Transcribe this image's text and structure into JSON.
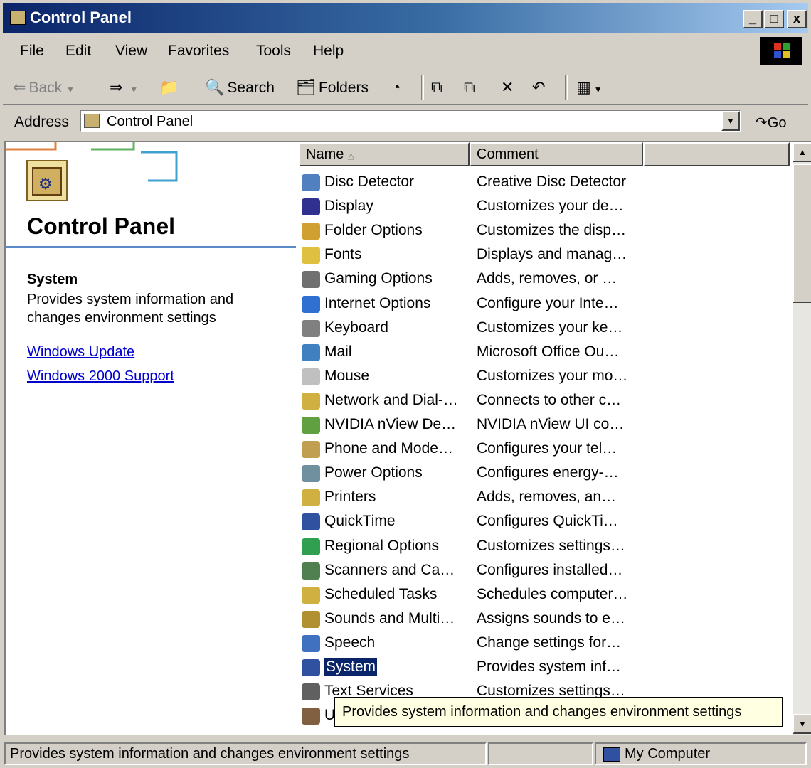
{
  "window": {
    "title": "Control Panel",
    "minimize": "_",
    "maximize": "□",
    "close": "x"
  },
  "menu": [
    "File",
    "Edit",
    "View",
    "Favorites",
    "Tools",
    "Help"
  ],
  "toolbar": {
    "back": "Back",
    "search": "Search",
    "folders": "Folders"
  },
  "address": {
    "label": "Address",
    "value": "Control Panel",
    "go": "Go"
  },
  "left_pane": {
    "title": "Control Panel",
    "selected_name": "System",
    "selected_desc": "Provides system information and changes environment settings",
    "links": [
      "Windows Update",
      "Windows 2000 Support"
    ]
  },
  "columns": [
    "Name",
    "Comment"
  ],
  "items": [
    {
      "name": "Disc Detector",
      "comment": "Creative Disc Detector",
      "color": "#5080c0"
    },
    {
      "name": "Display",
      "comment": "Customizes your de…",
      "color": "#303090"
    },
    {
      "name": "Folder Options",
      "comment": "Customizes the disp…",
      "color": "#d0a030"
    },
    {
      "name": "Fonts",
      "comment": "Displays and manag…",
      "color": "#e0c040"
    },
    {
      "name": "Gaming Options",
      "comment": "Adds, removes, or …",
      "color": "#707070"
    },
    {
      "name": "Internet Options",
      "comment": "Configure your Inte…",
      "color": "#3070d0"
    },
    {
      "name": "Keyboard",
      "comment": "Customizes your ke…",
      "color": "#808080"
    },
    {
      "name": "Mail",
      "comment": "Microsoft Office Ou…",
      "color": "#4080c0"
    },
    {
      "name": "Mouse",
      "comment": "Customizes your mo…",
      "color": "#c0c0c0"
    },
    {
      "name": "Network and Dial-…",
      "comment": "Connects to other c…",
      "color": "#d0b040"
    },
    {
      "name": "NVIDIA nView De…",
      "comment": "NVIDIA nView UI co…",
      "color": "#60a040"
    },
    {
      "name": "Phone and Mode…",
      "comment": "Configures your tel…",
      "color": "#c0a050"
    },
    {
      "name": "Power Options",
      "comment": "Configures energy-…",
      "color": "#7090a0"
    },
    {
      "name": "Printers",
      "comment": "Adds, removes, an…",
      "color": "#d0b040"
    },
    {
      "name": "QuickTime",
      "comment": "Configures QuickTi…",
      "color": "#3050a0"
    },
    {
      "name": "Regional Options",
      "comment": "Customizes settings…",
      "color": "#30a050"
    },
    {
      "name": "Scanners and Ca…",
      "comment": "Configures installed…",
      "color": "#508050"
    },
    {
      "name": "Scheduled Tasks",
      "comment": "Schedules computer…",
      "color": "#d0b040"
    },
    {
      "name": "Sounds and Multi…",
      "comment": "Assigns sounds to e…",
      "color": "#b09030"
    },
    {
      "name": "Speech",
      "comment": "Change settings for…",
      "color": "#4070c0"
    },
    {
      "name": "System",
      "comment": "Provides system inf…",
      "color": "#3050a0",
      "selected": true
    },
    {
      "name": "Text Services",
      "comment": "Customizes settings…",
      "color": "#606060"
    },
    {
      "name": "U",
      "comment": "",
      "color": "#806040"
    }
  ],
  "tooltip": "Provides system information and changes environment settings",
  "status": {
    "text": "Provides system information and changes environment settings",
    "zone": "My Computer"
  }
}
